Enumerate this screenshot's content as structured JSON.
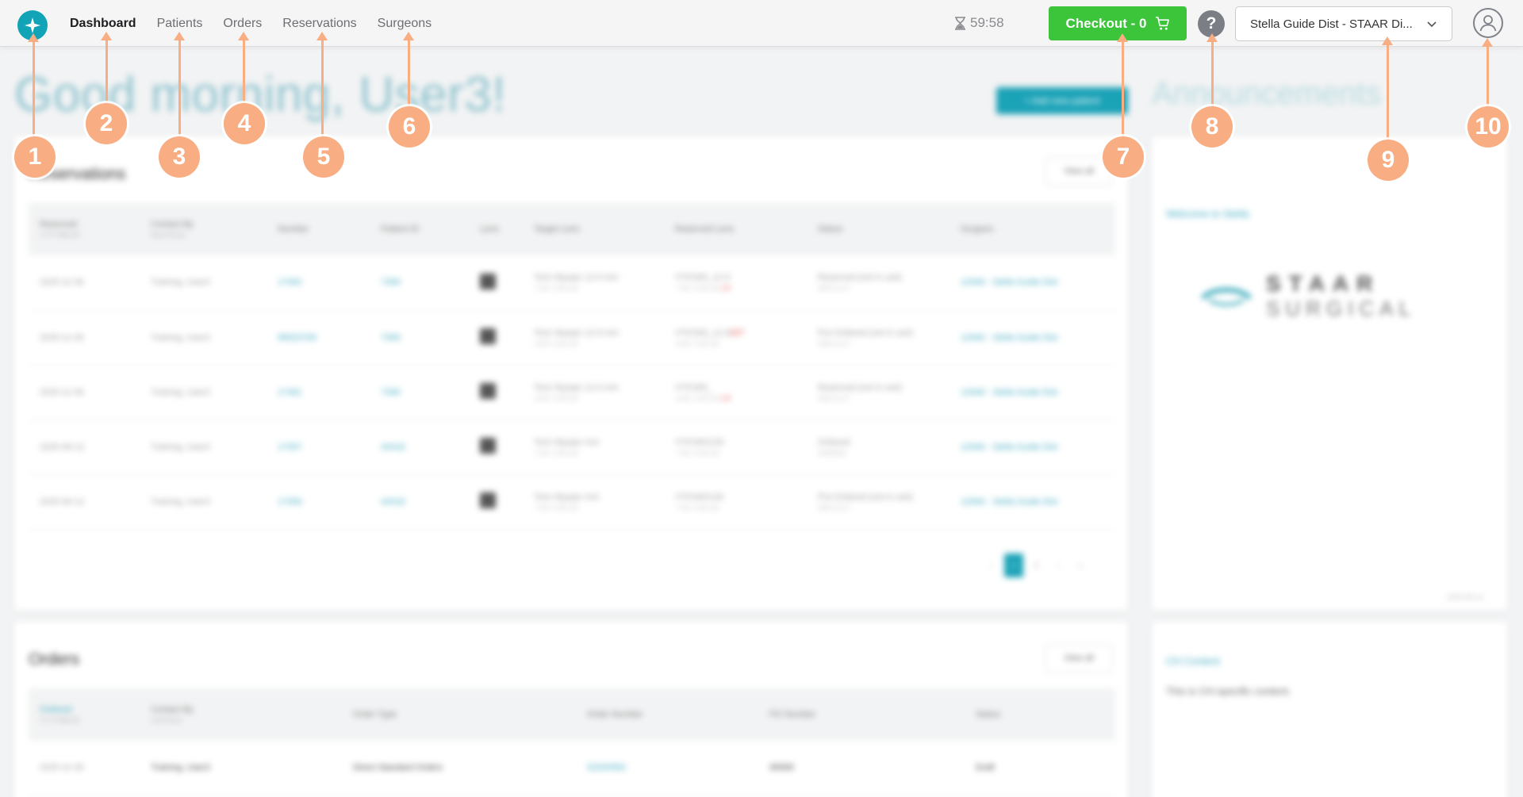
{
  "nav": {
    "items": [
      "Dashboard",
      "Patients",
      "Orders",
      "Reservations",
      "Surgeons"
    ],
    "active": "Dashboard"
  },
  "header": {
    "timer": "59:58",
    "checkout_label": "Checkout - 0",
    "help_label": "?",
    "account_label": "Stella Guide Dist - STAAR Di...",
    "icons": {
      "logo": "star-logo-icon",
      "timer": "hourglass-icon",
      "cart": "cart-icon",
      "dropdown": "chevron-down-icon",
      "profile": "user-icon"
    }
  },
  "page": {
    "greeting": "Good morning, User3!",
    "add_patient_label": "+ Add new patient",
    "announcements_title": "Announcements"
  },
  "reservations": {
    "title": "Reservations",
    "view_all": "View all",
    "columns": [
      {
        "label": "Reserved",
        "sub": "YYYY-MM-DD"
      },
      {
        "label": "Contact By",
        "sub": "Work Phone"
      },
      {
        "label": "Number",
        "sub": ""
      },
      {
        "label": "Patient ID",
        "sub": ""
      },
      {
        "label": "Lens",
        "sub": ""
      },
      {
        "label": "Target Lens",
        "sub": ""
      },
      {
        "label": "Reserved Lens",
        "sub": ""
      },
      {
        "label": "Status",
        "sub": ""
      },
      {
        "label": "Surgeon",
        "sub": ""
      }
    ],
    "rows": [
      {
        "reserved": "2025-11-06",
        "contact": "Training, User3",
        "number": "17462",
        "patient": "7399",
        "target": "Toric Myopic 12.6 mm",
        "target_sub": "-7.50 / 2.00 x10",
        "lens": "VTICMS_12.6",
        "lens_sub": "-7.50 / 2.00 x10",
        "lens_flag": "L/R",
        "status": "Reserved (not in cart)",
        "status_sub": "2025-11-27",
        "surgeon": "12946 - Stella Guide Dist"
      },
      {
        "reserved": "2025-11-06",
        "contact": "Training, User3",
        "number": "96920769",
        "patient": "7399",
        "target": "Toric Myopic 12.6 mm",
        "target_sub": "-8.00 / 2.00 x10",
        "lens": "VTICMS_12.6",
        "lens_sub": "-8.00 / 2.00 x10",
        "lens_flag": "307",
        "status": "Pre-Ordered (not in cart)",
        "status_sub": "2025-11-27",
        "surgeon": "12946 - Stella Guide Dist"
      },
      {
        "reserved": "2025-11-06",
        "contact": "Training, User3",
        "number": "17461",
        "patient": "7399",
        "target": "Toric Myopic 12.6 mm",
        "target_sub": "-8.00 / 2.00 x10",
        "lens": "VTICM5_",
        "lens_sub": "-8.00 / 2.00 x10",
        "lens_flag": "L/R",
        "status": "Reserved (not in cart)",
        "status_sub": "2025-11-27",
        "surgeon": "12946 - Stella Guide Dist"
      },
      {
        "reserved": "2025-06-12",
        "contact": "Training, User3",
        "number": "17457",
        "patient": "44418",
        "target": "Toric Myopic mm",
        "target_sub": "-7.50 / 2.00 x10",
        "lens": "VTICMO126",
        "lens_sub": "-7.50 / 2.00 x10",
        "lens_flag": "",
        "status": "Ordered",
        "status_sub": "52000582",
        "surgeon": "12946 - Stella Guide Dist"
      },
      {
        "reserved": "2025-06-12",
        "contact": "Training, User3",
        "number": "17456",
        "patient": "44418",
        "target": "Toric Myopic mm",
        "target_sub": "-7.50 / 2.00 x10",
        "lens": "VTICMO126",
        "lens_sub": "-7.50 / 2.00 x10",
        "lens_flag": "",
        "status": "Pre-Ordered (not in cart)",
        "status_sub": "2025-11-27",
        "surgeon": "12946 - Stella Guide Dist"
      }
    ],
    "pager": [
      "‹",
      "1",
      "2",
      "›",
      "»"
    ],
    "current_page": "1"
  },
  "orders": {
    "title": "Orders",
    "view_all": "View all",
    "columns": [
      {
        "label": "Ordered",
        "sub": "YYYY-MM-DD"
      },
      {
        "label": "Contact By",
        "sub": "Cell Phone"
      },
      {
        "label": "Order Type",
        "sub": ""
      },
      {
        "label": "Order Number",
        "sub": ""
      },
      {
        "label": "PO Number",
        "sub": ""
      },
      {
        "label": "Status",
        "sub": ""
      }
    ],
    "rows": [
      {
        "ordered": "2025-11-06",
        "contact": "Training, User3",
        "type": "Direct Standard Orders",
        "number": "52000582",
        "po": "99999",
        "status": "Draft"
      }
    ]
  },
  "announcements": {
    "welcome_heading": "Welcome to Stella",
    "logo_word1": "STAAR",
    "logo_word2": "SURGICAL",
    "welcome_date": "2025-08-14",
    "ch_heading": "CH Content",
    "ch_text": "This is CH-specific content."
  },
  "callouts": [
    "1",
    "2",
    "3",
    "4",
    "5",
    "6",
    "7",
    "8",
    "9",
    "10"
  ]
}
